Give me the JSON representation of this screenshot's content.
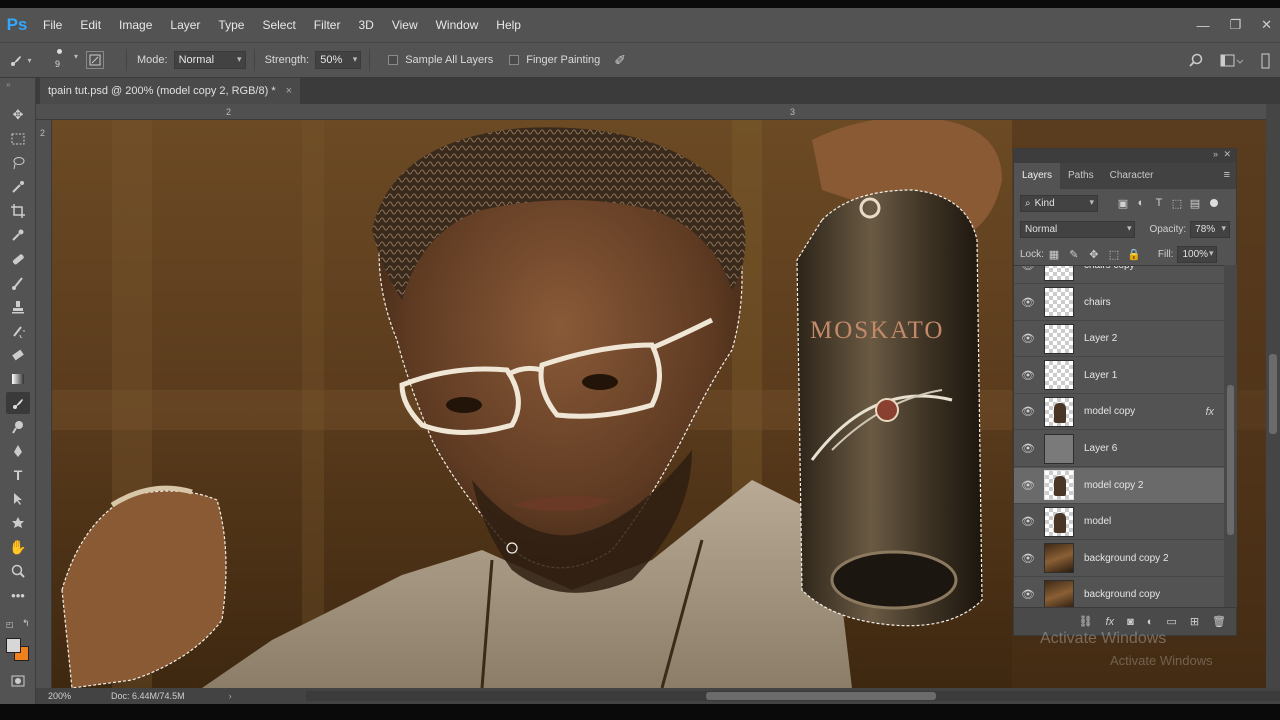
{
  "app": {
    "logo": "Ps",
    "menu": [
      "File",
      "Edit",
      "Image",
      "Layer",
      "Type",
      "Select",
      "Filter",
      "3D",
      "View",
      "Window",
      "Help"
    ],
    "window_controls": [
      "—",
      "❐",
      "✕"
    ]
  },
  "options": {
    "brush_size": "9",
    "mode_label": "Mode:",
    "mode_value": "Normal",
    "strength_label": "Strength:",
    "strength_value": "50%",
    "sample_all_layers": "Sample All Layers",
    "finger_painting": "Finger Painting"
  },
  "document": {
    "tab_title": "tpain tut.psd @ 200% (model copy 2, RGB/8) *",
    "close": "×",
    "ruler_h_marks": [
      "2",
      "3"
    ],
    "ruler_v_marks": [
      "2"
    ],
    "zoom": "200%",
    "doc_info": "Doc: 6.44M/74.5M",
    "bottle_label": "MOSKATO"
  },
  "layers_panel": {
    "tabs": [
      "Layers",
      "Paths",
      "Character"
    ],
    "filter_kind": "Kind",
    "blend_mode": "Normal",
    "opacity_label": "Opacity:",
    "opacity_value": "78%",
    "lock_label": "Lock:",
    "fill_label": "Fill:",
    "fill_value": "100%",
    "layers": [
      {
        "name": "chairs copy",
        "thumb": "check",
        "selected": false,
        "fx": false
      },
      {
        "name": "chairs",
        "thumb": "check",
        "selected": false,
        "fx": false
      },
      {
        "name": "Layer 2",
        "thumb": "check",
        "selected": false,
        "fx": false
      },
      {
        "name": "Layer 1",
        "thumb": "check",
        "selected": false,
        "fx": false
      },
      {
        "name": "model copy",
        "thumb": "model",
        "selected": false,
        "fx": true
      },
      {
        "name": "Layer 6",
        "thumb": "gray",
        "selected": false,
        "fx": false
      },
      {
        "name": "model copy 2",
        "thumb": "model",
        "selected": true,
        "fx": false
      },
      {
        "name": "model",
        "thumb": "model",
        "selected": false,
        "fx": false
      },
      {
        "name": "background copy 2",
        "thumb": "photo",
        "selected": false,
        "fx": false
      },
      {
        "name": "background copy",
        "thumb": "photo",
        "selected": false,
        "fx": false
      }
    ],
    "fx_label": "fx"
  },
  "watermark": {
    "line1": "Activate Windows",
    "line2": "Activate Windows"
  },
  "colors": {
    "foreground": "#d7d7d7",
    "background": "#f0811d",
    "ps_blue": "#31a8ff"
  }
}
